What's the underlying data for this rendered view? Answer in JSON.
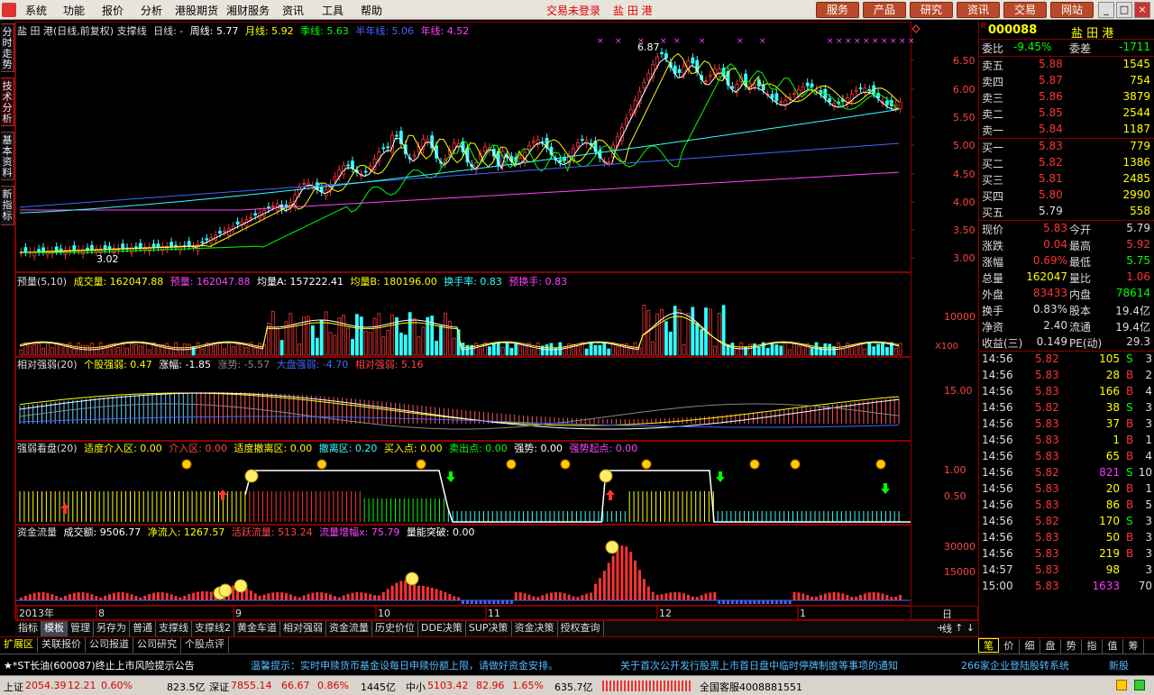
{
  "menu": [
    "系统",
    "功能",
    "报价",
    "分析",
    "港股期货",
    "湘财服务",
    "资讯",
    "工具",
    "帮助"
  ],
  "login_status": "交易未登录",
  "stock_title_bar": "盐 田 港",
  "right_buttons": [
    "服务",
    "产品",
    "研究",
    "资讯",
    "交易",
    "网站"
  ],
  "window_controls": [
    "_",
    "□",
    "×"
  ],
  "left_tabs": [
    "分时走势",
    "技术分析",
    "基本资料",
    "新指标"
  ],
  "main_panel": {
    "title": "盐 田 港(日线,前复权) 支撑线",
    "daily_label": "日线: -",
    "ma": [
      {
        "label": "周线: 5.77",
        "color": "#ffffff"
      },
      {
        "label": "月线: 5.92",
        "color": "#ffff00"
      },
      {
        "label": "季线: 5.63",
        "color": "#00ff00"
      },
      {
        "label": "半年线: 5.06",
        "color": "#4060ff"
      },
      {
        "label": "年线: 4.52",
        "color": "#ff40ff"
      }
    ],
    "price_axis": [
      "6.50",
      "6.00",
      "5.50",
      "5.00",
      "4.50",
      "4.00",
      "3.50",
      "3.00"
    ],
    "high_label": "6.87",
    "low_label": "3.02"
  },
  "vol_panel": {
    "title": "预量(5,10)",
    "items": [
      {
        "label": "成交量: 162047.88",
        "color": "#ffff00"
      },
      {
        "label": "预量: 162047.88",
        "color": "#ff40ff"
      },
      {
        "label": "均量A: 157222.41",
        "color": "#ffffff"
      },
      {
        "label": "均量B: 180196.00",
        "color": "#ffff00"
      },
      {
        "label": "换手率: 0.83",
        "color": "#00ffff"
      },
      {
        "label": "预换手: 0.83",
        "color": "#ff40ff"
      }
    ],
    "axis": [
      "10000"
    ],
    "unit": "X100"
  },
  "rs_panel": {
    "title": "相对强弱(20)",
    "items": [
      {
        "label": "个股强弱: 0.47",
        "color": "#ffff00"
      },
      {
        "label": "涨幅: -1.85",
        "color": "#ffffff"
      },
      {
        "label": "涨势: -5.57",
        "color": "#888888"
      },
      {
        "label": "大盘强弱: -4.70",
        "color": "#4060ff"
      },
      {
        "label": "相对强弱: 5.16",
        "color": "#ff4040"
      }
    ],
    "axis": [
      "15.00"
    ]
  },
  "sw_panel": {
    "title": "强弱看盘(20)",
    "items": [
      {
        "label": "适度介入区: 0.00",
        "color": "#ffff00"
      },
      {
        "label": "介入区: 0.00",
        "color": "#ff4040"
      },
      {
        "label": "适度撤离区: 0.00",
        "color": "#ffff00"
      },
      {
        "label": "撤离区: 0.20",
        "color": "#00ffff"
      },
      {
        "label": "买入点: 0.00",
        "color": "#ffff00"
      },
      {
        "label": "卖出点: 0.00",
        "color": "#00ff00"
      },
      {
        "label": "强势: 0.00",
        "color": "#ffffff"
      },
      {
        "label": "强势起点: 0.00",
        "color": "#ff40ff"
      }
    ],
    "axis": [
      "1.00",
      "0.50"
    ]
  },
  "mf_panel": {
    "title": "资金流量",
    "items": [
      {
        "label": "成交额: 9506.77",
        "color": "#ffffff"
      },
      {
        "label": "净流入: 1267.57",
        "color": "#ffff00"
      },
      {
        "label": "活跃流量: 513.24",
        "color": "#ff4040"
      },
      {
        "label": "流量增幅x: 75.79",
        "color": "#ff40ff"
      },
      {
        "label": "量能突破: 0.00",
        "color": "#ffffff"
      }
    ],
    "axis": [
      "30000",
      "15000"
    ]
  },
  "x_axis": [
    "2013年",
    "8",
    "9",
    "10",
    "11",
    "12",
    "1"
  ],
  "period_label": "日线",
  "tabs1": [
    "指标",
    "模板",
    "管理",
    "另存为",
    "普通",
    "支撑线",
    "支撑线2",
    "黄金车道",
    "相对强弱",
    "资金流量",
    "历史价位",
    "DDE决策",
    "SUP决策",
    "资金决策",
    "授权查询"
  ],
  "tabs1_active": "模板",
  "tabs2": [
    "扩展区",
    "关联报价",
    "公司报道",
    "公司研究",
    "个股点评"
  ],
  "rp": {
    "code": "000088",
    "name": "盐 田 港",
    "webi_label": "委比",
    "webi": "-9.45%",
    "weicha_label": "委差",
    "weicha": "-1711",
    "asks": [
      {
        "label": "卖五",
        "price": "5.88",
        "vol": "1545"
      },
      {
        "label": "卖四",
        "price": "5.87",
        "vol": "754"
      },
      {
        "label": "卖三",
        "price": "5.86",
        "vol": "3879"
      },
      {
        "label": "卖二",
        "price": "5.85",
        "vol": "2544"
      },
      {
        "label": "卖一",
        "price": "5.84",
        "vol": "1187"
      }
    ],
    "bids": [
      {
        "label": "买一",
        "price": "5.83",
        "vol": "779"
      },
      {
        "label": "买二",
        "price": "5.82",
        "vol": "1386"
      },
      {
        "label": "买三",
        "price": "5.81",
        "vol": "2485"
      },
      {
        "label": "买四",
        "price": "5.80",
        "vol": "2990"
      },
      {
        "label": "买五",
        "price": "5.79",
        "vol": "558"
      }
    ],
    "stats": [
      {
        "l1": "现价",
        "v1": "5.83",
        "c1": "red",
        "l2": "今开",
        "v2": "5.79",
        "c2": "wht"
      },
      {
        "l1": "涨跌",
        "v1": "0.04",
        "c1": "red",
        "l2": "最高",
        "v2": "5.92",
        "c2": "red"
      },
      {
        "l1": "涨幅",
        "v1": "0.69%",
        "c1": "red",
        "l2": "最低",
        "v2": "5.75",
        "c2": "grn"
      },
      {
        "l1": "总量",
        "v1": "162047",
        "c1": "yel",
        "l2": "量比",
        "v2": "1.06",
        "c2": "red"
      },
      {
        "l1": "外盘",
        "v1": "83433",
        "c1": "red",
        "l2": "内盘",
        "v2": "78614",
        "c2": "grn"
      },
      {
        "l1": "换手",
        "v1": "0.83%",
        "c1": "wht",
        "l2": "股本",
        "v2": "19.4亿",
        "c2": "wht"
      },
      {
        "l1": "净资",
        "v1": "2.40",
        "c1": "wht",
        "l2": "流通",
        "v2": "19.4亿",
        "c2": "wht"
      },
      {
        "l1": "收益(三)",
        "v1": "0.149",
        "c1": "wht",
        "l2": "PE(动)",
        "v2": "29.3",
        "c2": "wht"
      }
    ],
    "ticks": [
      {
        "t": "14:56",
        "p": "5.82",
        "v": "105",
        "s": "S",
        "n": "3",
        "vc": "yel"
      },
      {
        "t": "14:56",
        "p": "5.83",
        "v": "28",
        "s": "B",
        "n": "2",
        "vc": "yel"
      },
      {
        "t": "14:56",
        "p": "5.83",
        "v": "166",
        "s": "B",
        "n": "4",
        "vc": "yel"
      },
      {
        "t": "14:56",
        "p": "5.82",
        "v": "38",
        "s": "S",
        "n": "3",
        "vc": "yel"
      },
      {
        "t": "14:56",
        "p": "5.83",
        "v": "37",
        "s": "B",
        "n": "3",
        "vc": "yel"
      },
      {
        "t": "14:56",
        "p": "5.83",
        "v": "1",
        "s": "B",
        "n": "1",
        "vc": "yel"
      },
      {
        "t": "14:56",
        "p": "5.83",
        "v": "65",
        "s": "B",
        "n": "4",
        "vc": "yel"
      },
      {
        "t": "14:56",
        "p": "5.82",
        "v": "821",
        "s": "S",
        "n": "10",
        "vc": "mag"
      },
      {
        "t": "14:56",
        "p": "5.83",
        "v": "20",
        "s": "B",
        "n": "1",
        "vc": "yel"
      },
      {
        "t": "14:56",
        "p": "5.83",
        "v": "86",
        "s": "B",
        "n": "5",
        "vc": "yel"
      },
      {
        "t": "14:56",
        "p": "5.82",
        "v": "170",
        "s": "S",
        "n": "3",
        "vc": "yel"
      },
      {
        "t": "14:56",
        "p": "5.83",
        "v": "50",
        "s": "B",
        "n": "3",
        "vc": "yel"
      },
      {
        "t": "14:56",
        "p": "5.83",
        "v": "219",
        "s": "B",
        "n": "3",
        "vc": "yel"
      },
      {
        "t": "14:57",
        "p": "5.83",
        "v": "98",
        "s": "",
        "n": "3",
        "vc": "yel"
      },
      {
        "t": "15:00",
        "p": "5.83",
        "v": "1633",
        "s": "",
        "n": "70",
        "vc": "mag"
      }
    ]
  },
  "rp_tabs": [
    "笔",
    "价",
    "细",
    "盘",
    "势",
    "指",
    "值",
    "筹"
  ],
  "ticker": [
    "★*ST长油(600087)终止上市风险提示公告",
    "温馨提示：实时申赎货币基金设每日申赎份额上限，请做好资金安排。",
    "关于首次公开发行股票上市首日盘中临时停牌制度等事项的通知",
    "266家企业登陆股转系统",
    "新股"
  ],
  "status": {
    "sh_label": "上证",
    "sh": "2054.39",
    "sh_chg": "12.21",
    "sh_pct": "0.60%",
    "sh_amt": "823.5亿",
    "sz_label": "深证",
    "sz": "7855.14",
    "sz_chg": "66.67",
    "sz_pct": "0.86%",
    "sz_amt": "1445亿",
    "zx_label": "中小",
    "zx": "5103.42",
    "zx_chg": "82.96",
    "zx_pct": "1.65%",
    "zx_amt": "635.7亿",
    "service": "全国客服4008881551"
  }
}
